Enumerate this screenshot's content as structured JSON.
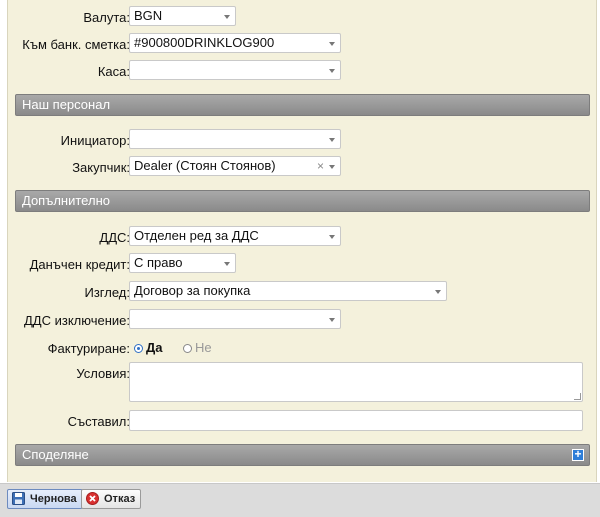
{
  "fields": {
    "currency": {
      "label": "Валута:",
      "value": "BGN"
    },
    "bank_account": {
      "label": "Към банк. сметка:",
      "value": "#900800DRINKLOG900"
    },
    "cashbox": {
      "label": "Каса:",
      "value": ""
    }
  },
  "sections": {
    "staff": "Наш персонал",
    "additional": "Допълнително",
    "sharing": "Споделяне"
  },
  "staff": {
    "initiator": {
      "label": "Инициатор:",
      "value": ""
    },
    "buyer": {
      "label": "Закупчик:",
      "value": "Dealer (Стоян Стоянов)",
      "clear": "×"
    }
  },
  "additional": {
    "vat": {
      "label": "ДДС:",
      "value": "Отделен ред за ДДС"
    },
    "tax_credit": {
      "label": "Данъчен кредит:",
      "value": "С право"
    },
    "view": {
      "label": "Изглед:",
      "value": "Договор за покупка"
    },
    "vat_exclusion": {
      "label": "ДДС изключение:",
      "value": ""
    },
    "invoicing": {
      "label": "Фактуриране:",
      "yes": "Да",
      "no": "Не",
      "selected": "yes"
    },
    "conditions": {
      "label": "Условия:",
      "value": ""
    },
    "author": {
      "label": "Съставил:",
      "value": ""
    }
  },
  "toolbar": {
    "draft": "Чернова",
    "cancel": "Отказ"
  },
  "colors": {
    "panel": "#f4f1dc",
    "section_header": "#9a9a9a",
    "accent": "#2f7ed8"
  }
}
